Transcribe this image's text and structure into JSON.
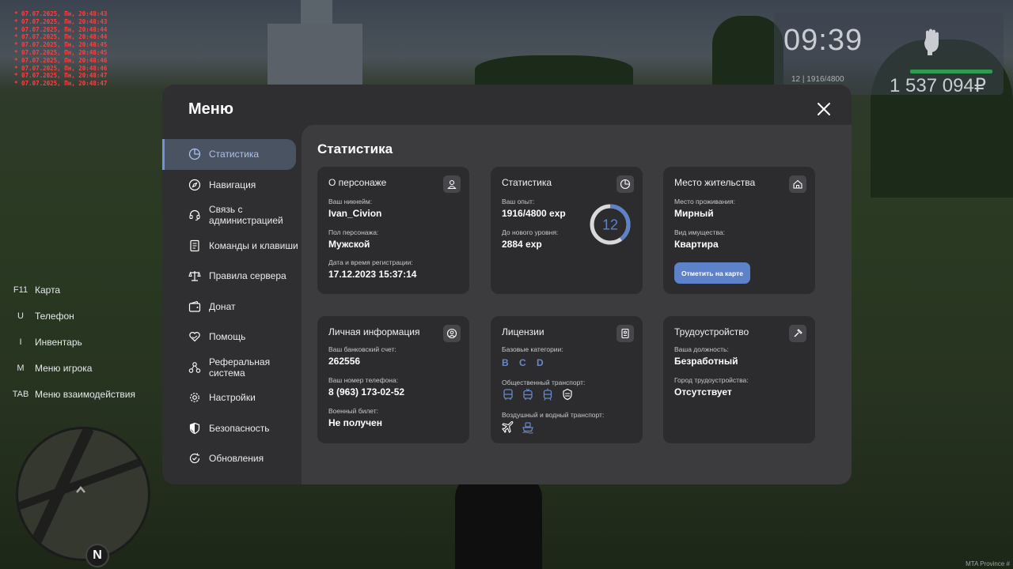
{
  "log_lines": [
    "* 07.07.2025, Пн, 20:48:43",
    "* 07.07.2025, Пн, 20:48:43",
    "* 07.07.2025, Пн, 20:48:44",
    "* 07.07.2025, Пн, 20:48:44",
    "* 07.07.2025, Пн, 20:48:45",
    "* 07.07.2025, Пн, 20:48:45",
    "* 07.07.2025, Пн, 20:48:46",
    "* 07.07.2025, Пн, 20:48:46",
    "* 07.07.2025, Пн, 20:48:47",
    "* 07.07.2025, Пн, 20:48:47"
  ],
  "hud": {
    "time": "09:39",
    "level_text": "12 | 1916/4800",
    "money": "1 537 094₽",
    "health_color": "#2e9d4f"
  },
  "hotkeys": [
    {
      "key": "F11",
      "label": "Карта"
    },
    {
      "key": "U",
      "label": "Телефон"
    },
    {
      "key": "I",
      "label": "Инвентарь"
    },
    {
      "key": "M",
      "label": "Меню игрока"
    },
    {
      "key": "TAB",
      "label": "Меню взаимодействия"
    }
  ],
  "compass": "N",
  "watermark": "MTA Province #",
  "menu": {
    "title": "Меню",
    "nav": [
      {
        "label": "Статистика",
        "icon": "pie-chart-icon",
        "active": true
      },
      {
        "label": "Навигация",
        "icon": "compass-icon"
      },
      {
        "label": "Связь с администрацией",
        "icon": "headset-icon"
      },
      {
        "label": "Команды и клавиши",
        "icon": "document-icon"
      },
      {
        "label": "Правила сервера",
        "icon": "scales-icon"
      },
      {
        "label": "Донат",
        "icon": "wallet-icon"
      },
      {
        "label": "Помощь",
        "icon": "heart-hands-icon"
      },
      {
        "label": "Реферальная система",
        "icon": "network-icon"
      },
      {
        "label": "Настройки",
        "icon": "gear-icon"
      },
      {
        "label": "Безопасность",
        "icon": "shield-icon"
      },
      {
        "label": "Обновления",
        "icon": "refresh-check-icon"
      }
    ],
    "content_title": "Статистика",
    "character": {
      "title": "О персонаже",
      "nickname_label": "Ваш никнейм:",
      "nickname": "Ivan_Civion",
      "gender_label": "Пол персонажа:",
      "gender": "Мужской",
      "reg_label": "Дата и время регистрации:",
      "reg_date": "17.12.2023 15:37:14"
    },
    "stats": {
      "title": "Статистика",
      "exp_label": "Ваш опыт:",
      "exp": "1916/4800 exp",
      "next_label": "До нового уровня:",
      "next": "2884 exp",
      "level": "12",
      "progress": 0.3992,
      "accent": "#5d82c9"
    },
    "residence": {
      "title": "Место жительства",
      "place_label": "Место проживания:",
      "place": "Мирный",
      "type_label": "Вид имущества:",
      "type": "Квартира",
      "button": "Отметить на карте"
    },
    "personal": {
      "title": "Личная информация",
      "bank_label": "Ваш банковский счет:",
      "bank": "262556",
      "phone_label": "Ваш номер телефона:",
      "phone": "8 (963) 173-02-52",
      "military_label": "Военный билет:",
      "military": "Не получен"
    },
    "licenses": {
      "title": "Лицензии",
      "base_label": "Базовые категории:",
      "categories": [
        "B",
        "C",
        "D"
      ],
      "public_label": "Общественный транспорт:",
      "public_icons": [
        "bus-icon",
        "trolleybus-icon",
        "tram-icon",
        "taxi-icon"
      ],
      "air_label": "Воздушный и водный транспорт:",
      "air_icons": [
        "plane-icon",
        "boat-icon"
      ]
    },
    "employment": {
      "title": "Трудоустройство",
      "position_label": "Ваша должность:",
      "position": "Безработный",
      "city_label": "Город трудоустройства:",
      "city": "Отсутствует"
    }
  }
}
